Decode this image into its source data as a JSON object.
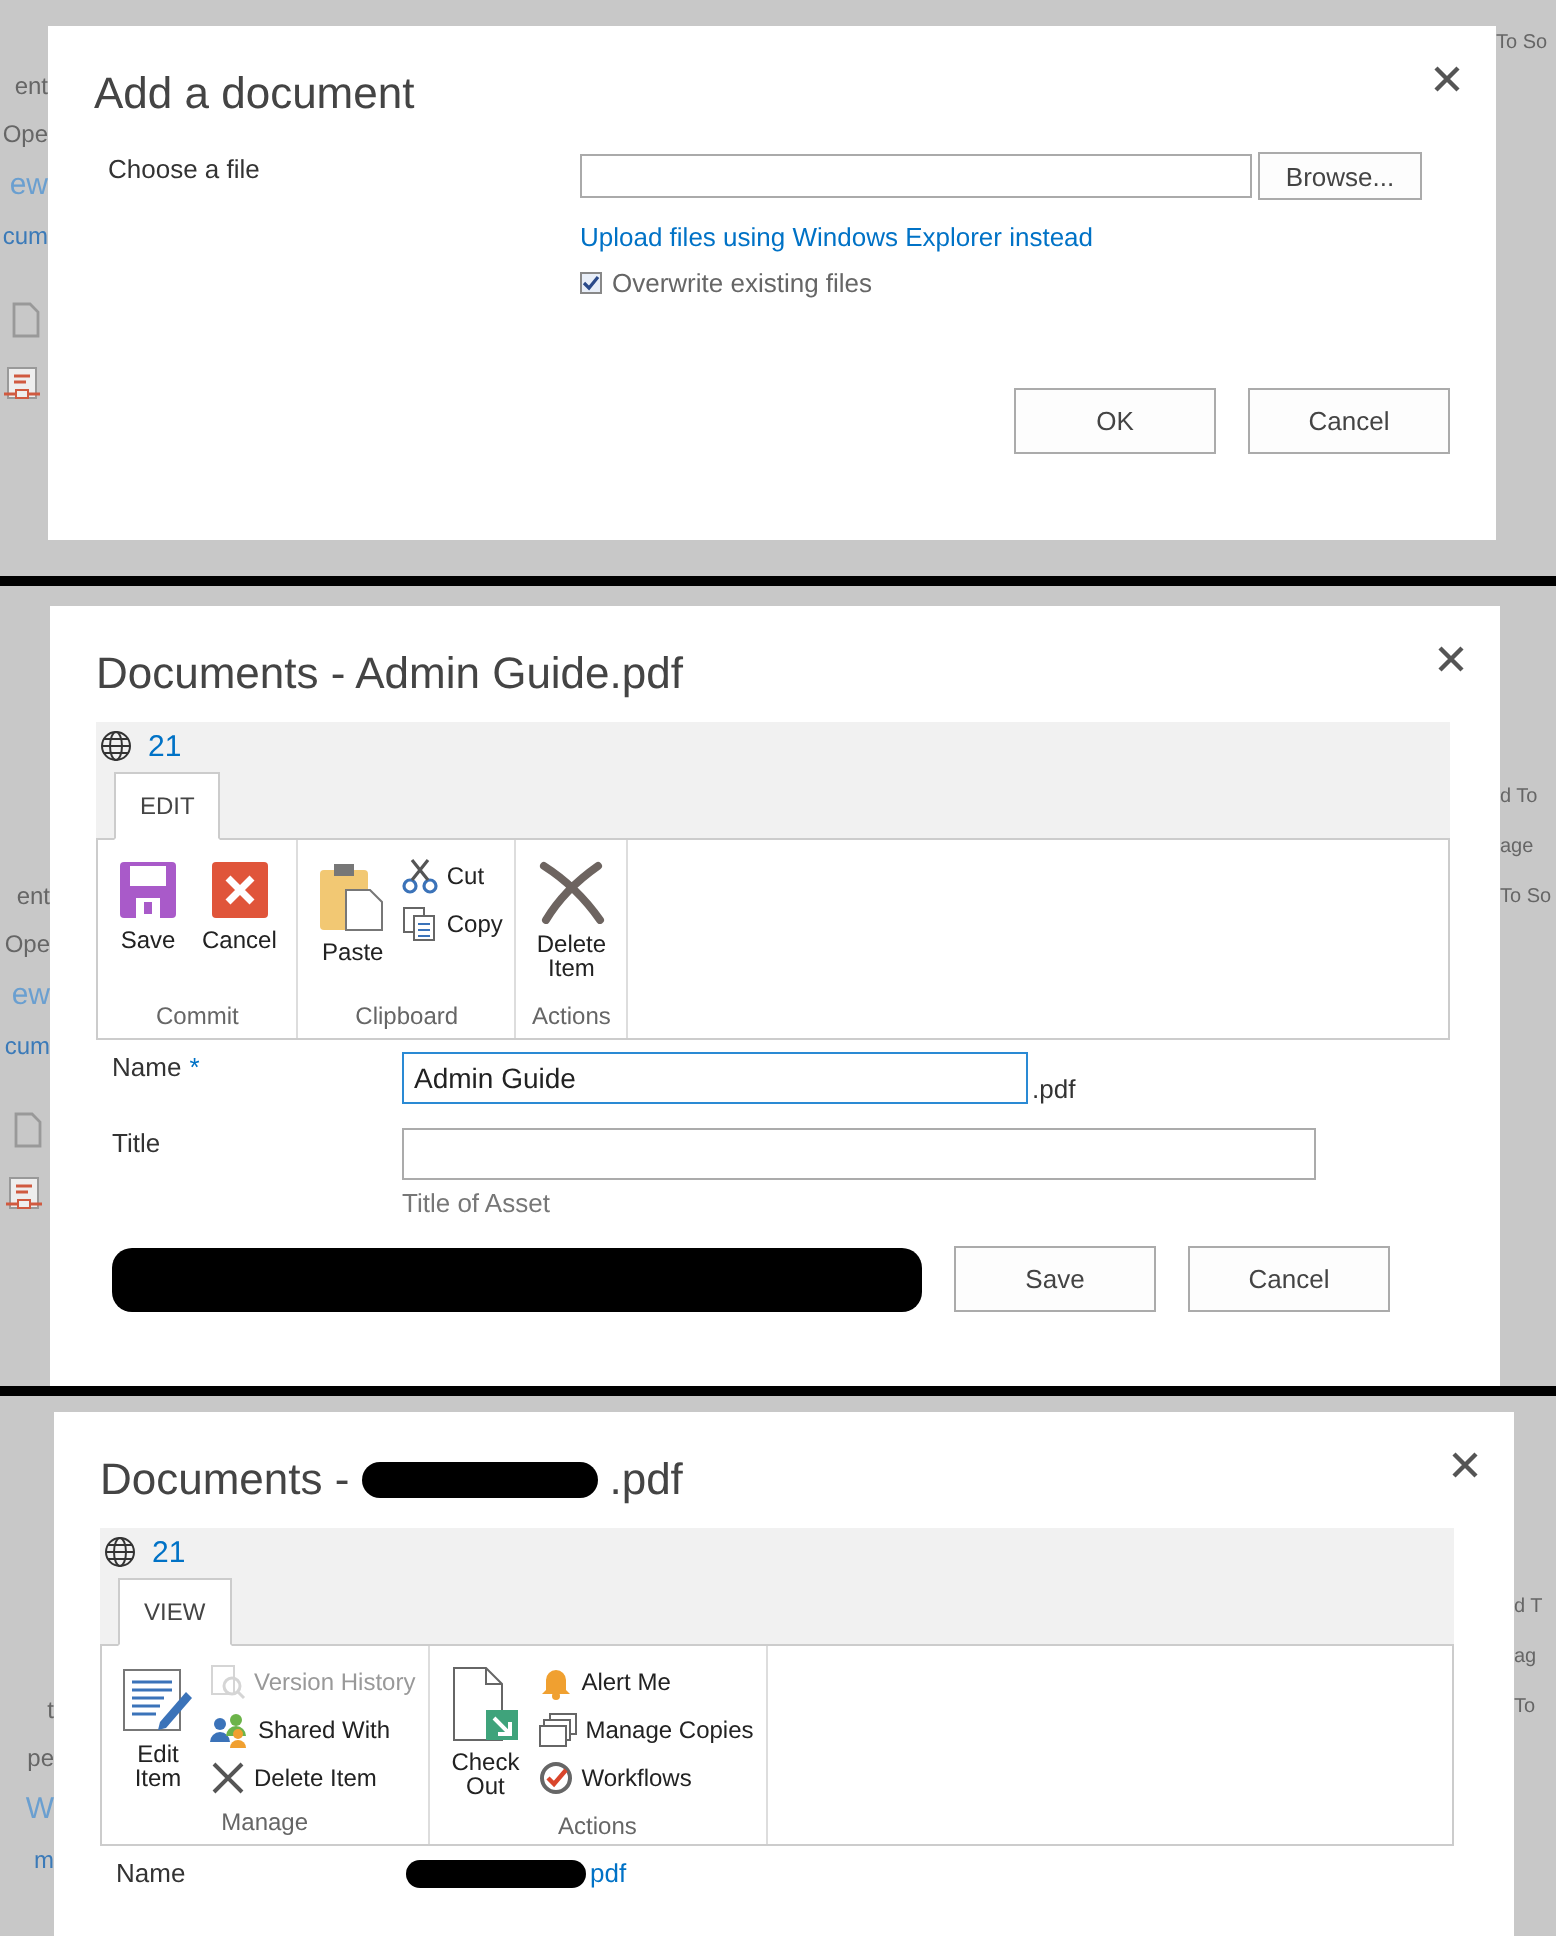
{
  "panels": [
    {
      "kind": "upload",
      "background": {
        "left": [
          {
            "kind": "text",
            "text": "ent"
          },
          {
            "kind": "text",
            "text": "Ope"
          },
          {
            "kind": "heading",
            "text": "ew"
          },
          {
            "kind": "link",
            "text": "cum"
          }
        ],
        "right": [
          "To So"
        ]
      },
      "dialog": {
        "title_parts": [
          {
            "kind": "text",
            "text": "Add a document"
          }
        ],
        "upload": {
          "label": "Choose a file",
          "browse": "Browse...",
          "link": "Upload files using Windows Explorer instead",
          "checkbox": {
            "label": "Overwrite existing files",
            "checked": true
          }
        },
        "buttons": [
          "OK",
          "Cancel"
        ]
      }
    },
    {
      "kind": "edit",
      "background": {
        "left": [
          {
            "kind": "text",
            "text": "ent"
          },
          {
            "kind": "text",
            "text": "Ope"
          },
          {
            "kind": "heading",
            "text": "ew"
          },
          {
            "kind": "link",
            "text": "cum"
          }
        ],
        "right": [
          "d To",
          "age",
          "To So"
        ]
      },
      "dialog": {
        "title_parts": [
          {
            "kind": "text",
            "text": "Documents - Admin Guide.pdf"
          }
        ],
        "ribbon": {
          "location": "21",
          "tabs": [
            {
              "label": "EDIT",
              "selected": true
            }
          ],
          "groups": [
            {
              "name": "Commit",
              "items": [
                {
                  "label": "Save",
                  "kind": "large",
                  "disabled": false
                },
                {
                  "label": "Cancel",
                  "kind": "large",
                  "disabled": false
                }
              ]
            },
            {
              "name": "Clipboard",
              "items": [
                {
                  "label": "Paste",
                  "kind": "large",
                  "disabled": false
                },
                {
                  "label": "Cut",
                  "kind": "small",
                  "disabled": false
                },
                {
                  "label": "Copy",
                  "kind": "small",
                  "disabled": false
                }
              ]
            },
            {
              "name": "Actions",
              "items": [
                {
                  "label": "Delete Item",
                  "kind": "large",
                  "disabled": false
                }
              ]
            }
          ]
        },
        "form": {
          "fields": [
            {
              "kind": "input",
              "label": "Name",
              "required_mark": "*",
              "value": "Admin Guide",
              "suffix": ".pdf",
              "focused": true
            },
            {
              "kind": "input",
              "label": "Title",
              "hint": "Title of Asset",
              "focused": false
            }
          ],
          "footer_redacted": true
        },
        "buttons": [
          "Save",
          "Cancel"
        ]
      }
    },
    {
      "kind": "view",
      "background": {
        "left": [
          {
            "kind": "text",
            "text": "t"
          },
          {
            "kind": "text",
            "text": "pe"
          },
          {
            "kind": "heading",
            "text": "W"
          },
          {
            "kind": "link",
            "text": "m"
          }
        ],
        "right": [
          "d T",
          "ag",
          "To"
        ]
      },
      "dialog": {
        "title_parts": [
          {
            "kind": "text",
            "text": "Documents -"
          },
          {
            "kind": "redacted"
          },
          {
            "kind": "text",
            "text": ".pdf"
          }
        ],
        "ribbon": {
          "location": "21",
          "tabs": [
            {
              "label": "VIEW",
              "selected": true
            }
          ],
          "groups": [
            {
              "name": "Manage",
              "items": [
                {
                  "label": "Edit Item",
                  "kind": "large",
                  "disabled": false
                },
                {
                  "label": "Version History",
                  "kind": "small",
                  "disabled": true
                },
                {
                  "label": "Shared With",
                  "kind": "small",
                  "disabled": false
                },
                {
                  "label": "Delete Item",
                  "kind": "small",
                  "disabled": false
                }
              ]
            },
            {
              "name": "Actions",
              "items": [
                {
                  "label": "Check Out",
                  "kind": "large",
                  "disabled": false
                },
                {
                  "label": "Alert Me",
                  "kind": "small",
                  "disabled": false
                },
                {
                  "label": "Manage Copies",
                  "kind": "small",
                  "disabled": false
                },
                {
                  "label": "Workflows",
                  "kind": "small",
                  "disabled": false
                }
              ]
            }
          ]
        },
        "form": {
          "fields": [
            {
              "kind": "link",
              "label": "Name",
              "value": "pdf",
              "redacted_prefix": true
            }
          ]
        }
      }
    }
  ]
}
